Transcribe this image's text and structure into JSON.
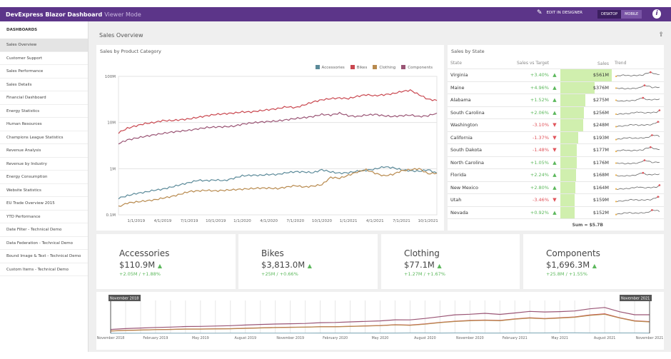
{
  "header": {
    "title": "DevExpress Blazor Dashboard",
    "mode": "Viewer Mode",
    "edit": "EDIT IN DESIGNER",
    "desktop": "DESKTOP",
    "mobile": "MOBILE",
    "info": "i"
  },
  "sidebar": {
    "heading": "DASHBOARDS",
    "items": [
      "Sales Overview",
      "Customer Support",
      "Sales Performance",
      "Sales Details",
      "Financial Dashboard",
      "Energy Statistics",
      "Human Resources",
      "Champions League Statistics",
      "Revenue Analysis",
      "Revenue by Industry",
      "Energy Consumption",
      "Website Statistics",
      "EU Trade Overview 2015",
      "YTD Performance",
      "Date Filter - Technical Demo",
      "Data Federation - Technical Demo",
      "Bound Image & Text - Technical Demo",
      "Custom Items - Technical Demo"
    ],
    "selected": 0
  },
  "page": {
    "title": "Sales Overview"
  },
  "colors": {
    "Accessories": "#5b8a99",
    "Bikes": "#c9474f",
    "Clothing": "#b88a4e",
    "Components": "#9a5575",
    "accent": "#5c3589",
    "bar": "#d0efae"
  },
  "chart_data": {
    "type": "line",
    "title": "Sales by Product Category",
    "scale": "log",
    "ylim": [
      0.1,
      100
    ],
    "yticks": [
      "100M",
      "10M",
      "1M",
      "0.1M"
    ],
    "ytickvals": [
      100,
      10,
      1,
      0.1
    ],
    "grid": true,
    "legend": "top-right",
    "xticks": [
      "1/1/2019",
      "4/1/2019",
      "7/1/2019",
      "10/1/2019",
      "1/1/2020",
      "4/1/2020",
      "7/1/2020",
      "10/1/2020",
      "1/1/2021",
      "4/1/2021",
      "7/1/2021",
      "10/1/2021"
    ],
    "x": [
      "2018-11",
      "2018-12",
      "2019-01",
      "2019-02",
      "2019-03",
      "2019-04",
      "2019-05",
      "2019-06",
      "2019-07",
      "2019-08",
      "2019-09",
      "2019-10",
      "2019-11",
      "2019-12",
      "2020-01",
      "2020-02",
      "2020-03",
      "2020-04",
      "2020-05",
      "2020-06",
      "2020-07",
      "2020-08",
      "2020-09",
      "2020-10",
      "2020-11",
      "2020-12",
      "2021-01",
      "2021-02",
      "2021-03",
      "2021-04",
      "2021-05",
      "2021-06",
      "2021-07",
      "2021-08",
      "2021-09",
      "2021-10",
      "2021-11"
    ],
    "series": [
      {
        "name": "Accessories",
        "values": [
          0.23,
          0.26,
          0.29,
          0.31,
          0.34,
          0.36,
          0.4,
          0.45,
          0.5,
          0.56,
          0.55,
          0.57,
          0.55,
          0.62,
          0.7,
          0.72,
          0.72,
          0.75,
          0.75,
          0.82,
          0.86,
          0.85,
          0.82,
          0.95,
          0.85,
          0.8,
          0.82,
          0.88,
          0.92,
          0.98,
          1.1,
          1.05,
          0.95,
          0.9,
          0.88,
          0.95,
          0.8
        ]
      },
      {
        "name": "Bikes",
        "values": [
          6,
          7.5,
          8.5,
          9.5,
          10,
          11,
          11,
          11.5,
          12,
          13,
          14,
          15,
          15.5,
          16,
          17,
          17,
          18,
          19,
          20,
          22,
          21,
          24,
          28,
          31,
          33,
          34,
          33,
          37,
          40,
          38,
          40,
          42,
          47,
          50,
          40,
          32,
          30
        ]
      },
      {
        "name": "Clothing",
        "values": [
          0.15,
          0.18,
          0.19,
          0.2,
          0.21,
          0.23,
          0.25,
          0.28,
          0.32,
          0.33,
          0.34,
          0.33,
          0.34,
          0.35,
          0.36,
          0.37,
          0.38,
          0.38,
          0.37,
          0.4,
          0.43,
          0.4,
          0.42,
          0.45,
          0.65,
          0.62,
          0.72,
          0.85,
          0.95,
          0.8,
          0.7,
          0.75,
          0.9,
          0.95,
          1.0,
          0.78,
          0.8
        ]
      },
      {
        "name": "Components",
        "values": [
          3.5,
          4.2,
          4.6,
          5.0,
          5.4,
          5.8,
          6.2,
          6.5,
          6.8,
          7.3,
          7.8,
          8.0,
          8.1,
          8.3,
          9.2,
          9.8,
          10.2,
          10.5,
          10.8,
          11.5,
          12.2,
          12.8,
          13.5,
          15,
          14.5,
          16,
          14,
          13.5,
          14.5,
          15,
          14,
          13.5,
          14,
          14.5,
          13.5,
          14,
          16
        ]
      }
    ]
  },
  "grid": {
    "title": "Sales by State",
    "headers": [
      "State",
      "Sales vs Target",
      "Sales",
      "Trend"
    ],
    "rows": [
      {
        "state": "Virginia",
        "delta": "+3.40%",
        "dir": "up",
        "sales": "$561M",
        "value": 561
      },
      {
        "state": "Maine",
        "delta": "+4.96%",
        "dir": "up",
        "sales": "$376M",
        "value": 376
      },
      {
        "state": "Alabama",
        "delta": "+1.52%",
        "dir": "up",
        "sales": "$275M",
        "value": 275
      },
      {
        "state": "South Carolina",
        "delta": "+2.06%",
        "dir": "up",
        "sales": "$256M",
        "value": 256
      },
      {
        "state": "Washington",
        "delta": "-3.10%",
        "dir": "down",
        "sales": "$248M",
        "value": 248
      },
      {
        "state": "California",
        "delta": "-1.37%",
        "dir": "down",
        "sales": "$193M",
        "value": 193
      },
      {
        "state": "South Dakota",
        "delta": "-1.48%",
        "dir": "down",
        "sales": "$177M",
        "value": 177
      },
      {
        "state": "North Carolina",
        "delta": "+1.05%",
        "dir": "up",
        "sales": "$176M",
        "value": 176
      },
      {
        "state": "Florida",
        "delta": "+2.24%",
        "dir": "up",
        "sales": "$168M",
        "value": 168
      },
      {
        "state": "New Mexico",
        "delta": "+2.80%",
        "dir": "up",
        "sales": "$164M",
        "value": 164
      },
      {
        "state": "Utah",
        "delta": "-3.46%",
        "dir": "down",
        "sales": "$159M",
        "value": 159
      },
      {
        "state": "Nevada",
        "delta": "+0.92%",
        "dir": "up",
        "sales": "$152M",
        "value": 152
      }
    ],
    "sum": "Sum = $5.7B"
  },
  "cards": [
    {
      "name": "Accessories",
      "value": "$110.9M",
      "delta": "+2.05M / +1.88%"
    },
    {
      "name": "Bikes",
      "value": "$3,813.0M",
      "delta": "+25M / +0.66%"
    },
    {
      "name": "Clothing",
      "value": "$77.1M",
      "delta": "+1.27M / +1.67%"
    },
    {
      "name": "Components",
      "value": "$1,696.3M",
      "delta": "+25.8M / +1.55%"
    }
  ],
  "range": {
    "start": "November 2018",
    "end": "November 2021",
    "ticks": [
      "November 2018",
      "February 2019",
      "May 2019",
      "August 2019",
      "November 2019",
      "February 2020",
      "May 2020",
      "August 2020",
      "November 2020",
      "February 2021",
      "May 2021",
      "August 2021",
      "November 2021"
    ]
  }
}
